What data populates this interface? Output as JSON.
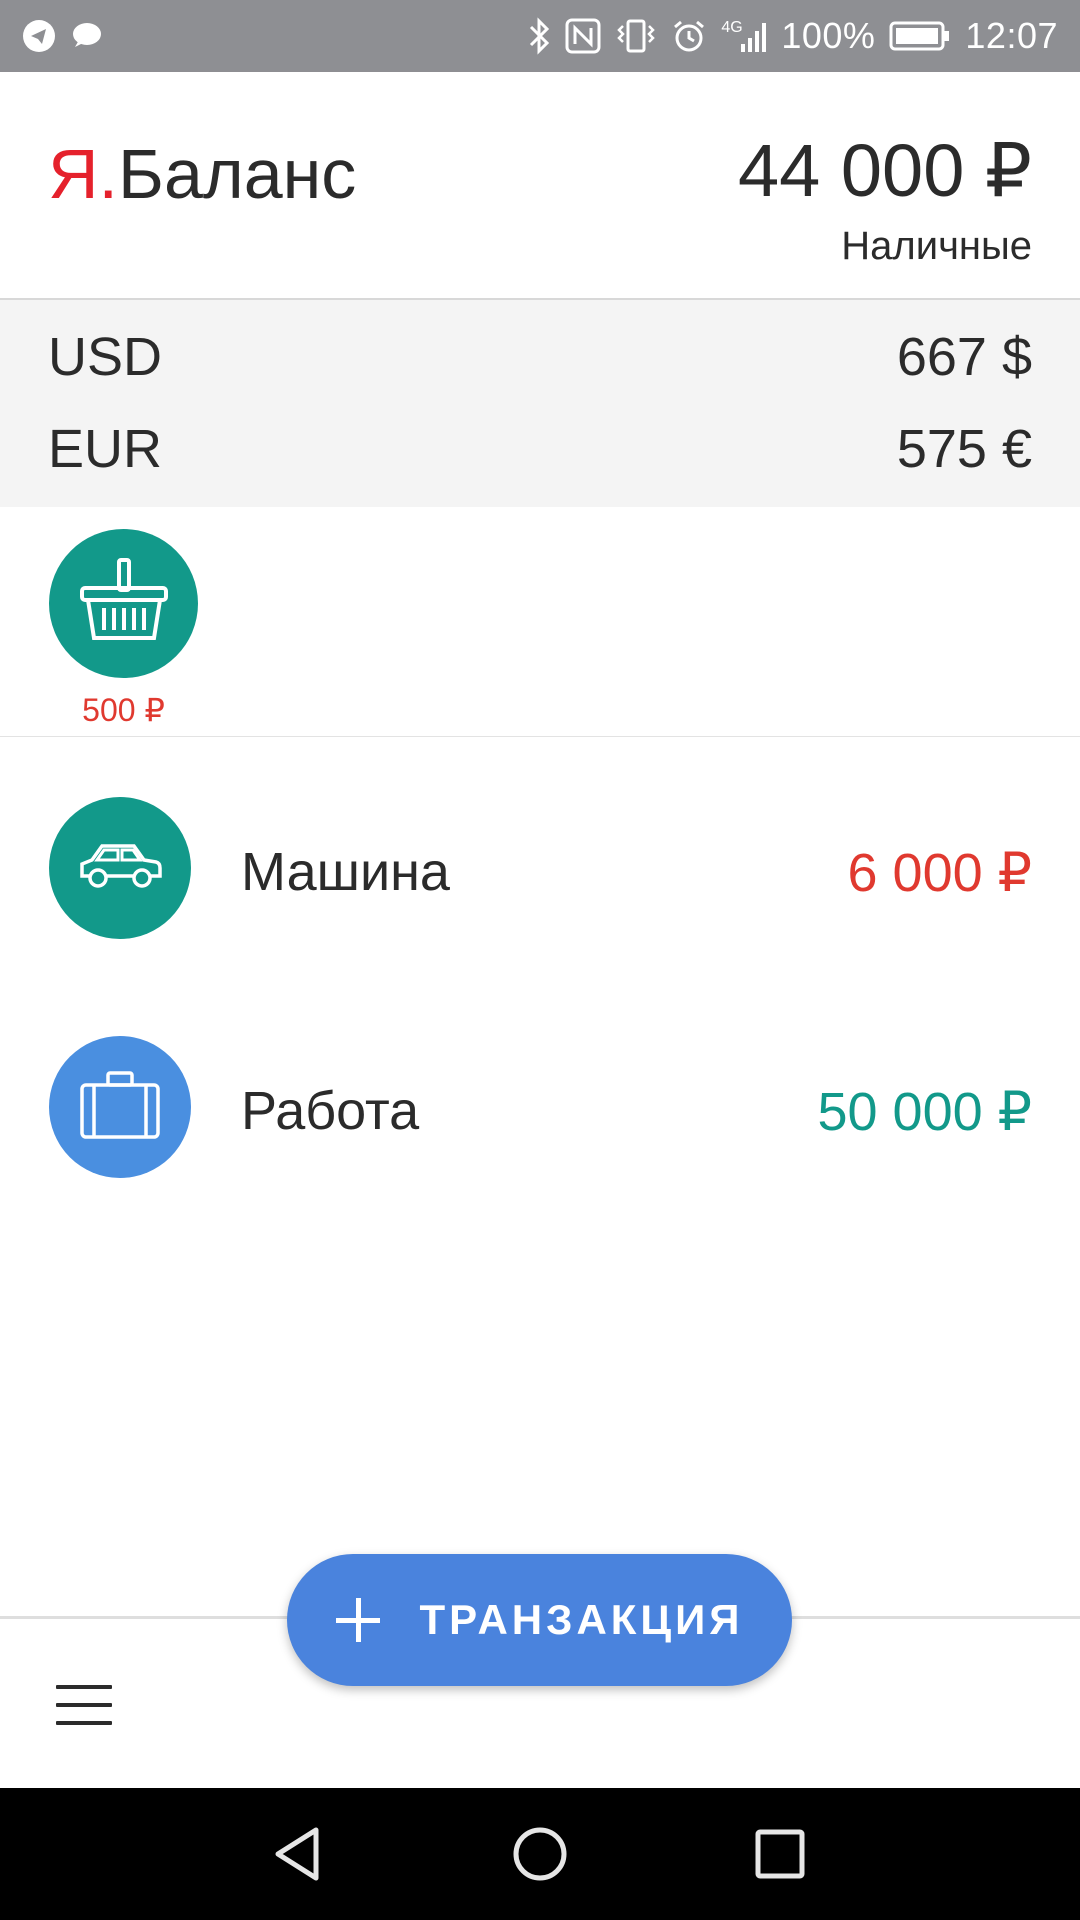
{
  "status_bar": {
    "battery": "100%",
    "time": "12:07",
    "network": "4G",
    "left_icons": [
      "telegram-icon",
      "chat-bubble-icon"
    ],
    "right_icons": [
      "bluetooth-icon",
      "nfc-icon",
      "vibrate-icon",
      "alarm-icon",
      "signal-icon",
      "battery-icon"
    ]
  },
  "header": {
    "brand_prefix": "Я.",
    "brand_name": "Баланс",
    "total": "44 000 ₽",
    "account": "Наличные"
  },
  "currencies": [
    {
      "code": "USD",
      "amount": "667 $"
    },
    {
      "code": "EUR",
      "amount": "575 €"
    }
  ],
  "expense_bubble": {
    "icon": "shopping-basket-icon",
    "amount": "500 ₽",
    "color": "#12998a"
  },
  "categories": [
    {
      "label": "Машина",
      "amount": "6 000 ₽",
      "icon": "car-icon",
      "icon_color": "#12998a",
      "amount_color": "#e0392f"
    },
    {
      "label": "Работа",
      "amount": "50 000 ₽",
      "icon": "briefcase-icon",
      "icon_color": "#4a8fe0",
      "amount_color": "#12998a"
    }
  ],
  "fab": {
    "label": "ТРАНЗАКЦИЯ",
    "icon": "plus-icon",
    "color": "#4a83dd"
  },
  "bottom_bar": {
    "menu_icon": "hamburger-menu-icon"
  },
  "nav_bar": {
    "buttons": [
      "back-icon",
      "home-icon",
      "recents-icon"
    ]
  },
  "colors": {
    "brand_accent": "#e5212c",
    "status_bar": "#8e8f93",
    "expense_red": "#e0392f",
    "income_green": "#12998a"
  }
}
